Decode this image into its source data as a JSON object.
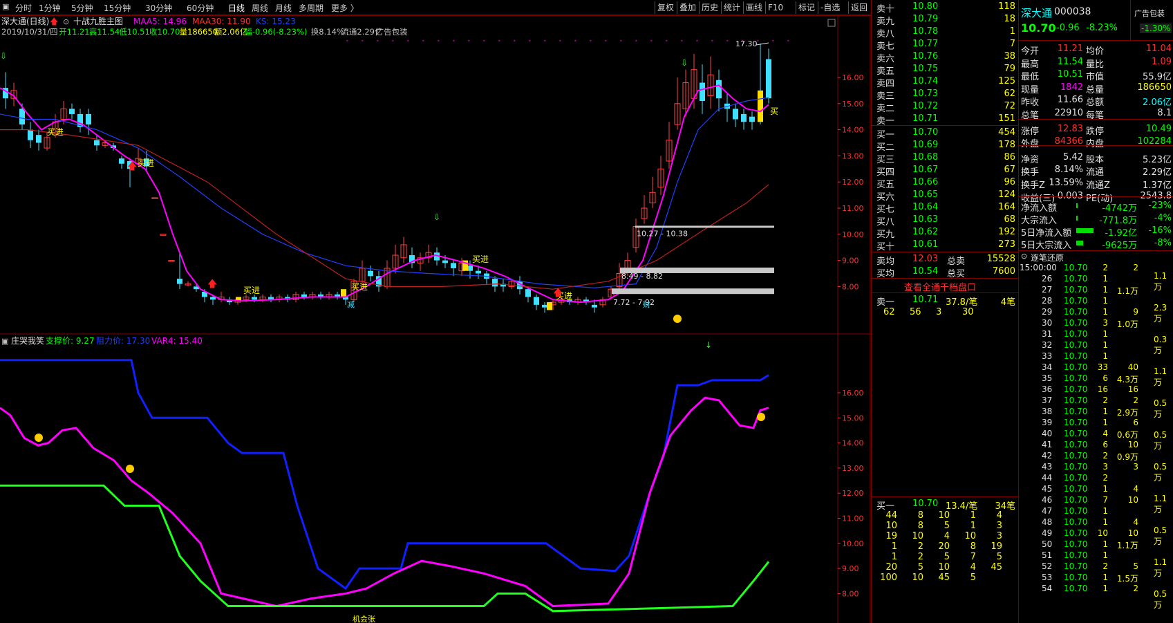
{
  "toolbar": {
    "periods": [
      "分时",
      "1分钟",
      "5分钟",
      "15分钟",
      "30分钟",
      "60分钟",
      "日线",
      "周线",
      "月线",
      "多周期",
      "更多 〉"
    ],
    "active": "日线",
    "right_buttons": [
      "复权",
      "叠加",
      "历史",
      "统计",
      "画线",
      "F10",
      "标记",
      "-自选",
      "返回"
    ]
  },
  "main_chart": {
    "title": "深大通(日线)",
    "indicator_name": "十战九胜主图",
    "ma_labels": [
      {
        "text": "MAA5: 14.96",
        "color": "#ff00ff"
      },
      {
        "text": "MAA30: 11.90",
        "color": "#ff3030"
      },
      {
        "text": "KS: 15.23",
        "color": "#2040ff"
      }
    ],
    "info_line": [
      {
        "t": "2019/10/31/四",
        "c": "#c0c0c0"
      },
      {
        "t": "开11.21",
        "c": "#00ff00"
      },
      {
        "t": "高11.54",
        "c": "#00ff00"
      },
      {
        "t": "低10.51",
        "c": "#00ff00"
      },
      {
        "t": "收10.70",
        "c": "#00ff00"
      },
      {
        "t": "量186650",
        "c": "#ffff00"
      },
      {
        "t": "额2.06亿",
        "c": "#ffff00"
      },
      {
        "t": "幅-0.96(-8.23%)",
        "c": "#00ff00"
      },
      {
        "t": "换8.14%",
        "c": "#c0c0c0"
      },
      {
        "t": "流通2.29亿",
        "c": "#c0c0c0"
      },
      {
        "t": "广告包装",
        "c": "#c0c0c0"
      }
    ],
    "y_ticks": [
      "16.00",
      "15.00",
      "14.00",
      "13.00",
      "12.00",
      "11.00",
      "10.00",
      "9.00",
      "8.00"
    ],
    "high_label": "17.30",
    "zones": [
      "10.27 - 10.38",
      "8.49 - 8.82",
      "7.72 - 7.92"
    ],
    "buy_labels": [
      "买进",
      "买进",
      "买进",
      "买进",
      "买进",
      "买进",
      "买"
    ],
    "markers": [
      "减",
      "财"
    ]
  },
  "sub_chart": {
    "indicator_name": "庄哭我笑",
    "labels": [
      {
        "text": "支撑价: 9.27",
        "color": "#00ff00"
      },
      {
        "text": "阻力价: 17.30",
        "color": "#2040ff"
      },
      {
        "text": "VAR4: 15.40",
        "color": "#ff00ff"
      }
    ],
    "y_ticks": [
      "16.00",
      "15.00",
      "14.00",
      "13.00",
      "12.00",
      "11.00",
      "10.00",
      "9.00",
      "8.00"
    ],
    "bottom_label": "机会张"
  },
  "orderbook": {
    "asks": [
      {
        "l": "卖十",
        "p": "10.80",
        "v": "118"
      },
      {
        "l": "卖九",
        "p": "10.79",
        "v": "18"
      },
      {
        "l": "卖八",
        "p": "10.78",
        "v": "1"
      },
      {
        "l": "卖七",
        "p": "10.77",
        "v": "7"
      },
      {
        "l": "卖六",
        "p": "10.76",
        "v": "38"
      },
      {
        "l": "卖五",
        "p": "10.75",
        "v": "79"
      },
      {
        "l": "卖四",
        "p": "10.74",
        "v": "125"
      },
      {
        "l": "卖三",
        "p": "10.73",
        "v": "62"
      },
      {
        "l": "卖二",
        "p": "10.72",
        "v": "72"
      },
      {
        "l": "卖一",
        "p": "10.71",
        "v": "151"
      }
    ],
    "bids": [
      {
        "l": "买一",
        "p": "10.70",
        "v": "454"
      },
      {
        "l": "买二",
        "p": "10.69",
        "v": "178"
      },
      {
        "l": "买三",
        "p": "10.68",
        "v": "86"
      },
      {
        "l": "买四",
        "p": "10.67",
        "v": "67"
      },
      {
        "l": "买五",
        "p": "10.66",
        "v": "96"
      },
      {
        "l": "买六",
        "p": "10.65",
        "v": "124"
      },
      {
        "l": "买七",
        "p": "10.64",
        "v": "164"
      },
      {
        "l": "买八",
        "p": "10.63",
        "v": "68"
      },
      {
        "l": "买九",
        "p": "10.62",
        "v": "192"
      },
      {
        "l": "买十",
        "p": "10.61",
        "v": "273"
      }
    ],
    "avg_ask": {
      "l": "卖均",
      "p": "12.03",
      "l2": "总卖",
      "v": "15528"
    },
    "avg_bid": {
      "l": "买均",
      "p": "10.54",
      "l2": "总买",
      "v": "7600"
    },
    "view_all": "查看全通千档盘口",
    "ask1_queue": {
      "l": "卖一",
      "p": "10.71",
      "avg": "37.8/笔",
      "n": "4笔",
      "orders": [
        [
          "62",
          "56",
          "3",
          "30"
        ]
      ]
    },
    "bid1_queue": {
      "l": "买一",
      "p": "10.70",
      "avg": "13.4/笔",
      "n": "34笔",
      "orders": [
        [
          "44",
          "8",
          "10",
          "1",
          "4"
        ],
        [
          "10",
          "8",
          "5",
          "1",
          "3"
        ],
        [
          "19",
          "10",
          "4",
          "10",
          "3"
        ],
        [
          "1",
          "2",
          "20",
          "8",
          "19"
        ],
        [
          "1",
          "2",
          "5",
          "7",
          "5"
        ],
        [
          "20",
          "5",
          "10",
          "4",
          "45"
        ],
        [
          "100",
          "10",
          "45",
          "5",
          ""
        ]
      ]
    }
  },
  "stock": {
    "name": "深大通",
    "code": "000038",
    "ad": "广告包装",
    "price": "10.70",
    "change": "-0.96",
    "pct": "-8.23%",
    "ad_pct": "-1.30%"
  },
  "quote": [
    [
      {
        "t": "今开",
        "c": "wht"
      },
      {
        "t": "11.21",
        "c": "red"
      },
      {
        "t": "均价",
        "c": "wht"
      },
      {
        "t": "11.04",
        "c": "red"
      }
    ],
    [
      {
        "t": "最高",
        "c": "wht"
      },
      {
        "t": "11.54",
        "c": "grn"
      },
      {
        "t": "量比",
        "c": "wht"
      },
      {
        "t": "1.09",
        "c": "red"
      }
    ],
    [
      {
        "t": "最低",
        "c": "wht"
      },
      {
        "t": "10.51",
        "c": "grn"
      },
      {
        "t": "市值",
        "c": "wht"
      },
      {
        "t": "55.9亿",
        "c": "wht"
      }
    ],
    [
      {
        "t": "现量",
        "c": "wht"
      },
      {
        "t": "1842",
        "c": "mag"
      },
      {
        "t": "总量",
        "c": "wht"
      },
      {
        "t": "186650",
        "c": "yel"
      }
    ],
    [
      {
        "t": "昨收",
        "c": "wht"
      },
      {
        "t": "11.66",
        "c": "wht"
      },
      {
        "t": "总额",
        "c": "wht"
      },
      {
        "t": "2.06亿",
        "c": "cy"
      }
    ],
    [
      {
        "t": "总笔",
        "c": "wht"
      },
      {
        "t": "22910",
        "c": "wht"
      },
      {
        "t": "每笔",
        "c": "wht"
      },
      {
        "t": "8.1",
        "c": "wht"
      }
    ],
    [
      {
        "t": "涨停",
        "c": "wht"
      },
      {
        "t": "12.83",
        "c": "red"
      },
      {
        "t": "跌停",
        "c": "wht"
      },
      {
        "t": "10.49",
        "c": "grn"
      }
    ],
    [
      {
        "t": "外盘",
        "c": "wht"
      },
      {
        "t": "84366",
        "c": "red"
      },
      {
        "t": "内盘",
        "c": "wht"
      },
      {
        "t": "102284",
        "c": "grn"
      }
    ],
    [
      {
        "t": "净资",
        "c": "wht"
      },
      {
        "t": "5.42",
        "c": "wht"
      },
      {
        "t": "股本",
        "c": "wht"
      },
      {
        "t": "5.23亿",
        "c": "wht"
      }
    ],
    [
      {
        "t": "换手",
        "c": "wht"
      },
      {
        "t": "8.14%",
        "c": "wht"
      },
      {
        "t": "流通",
        "c": "wht"
      },
      {
        "t": "2.29亿",
        "c": "wht"
      }
    ],
    [
      {
        "t": "换手Z",
        "c": "wht"
      },
      {
        "t": "13.59%",
        "c": "wht"
      },
      {
        "t": "流通Z",
        "c": "wht"
      },
      {
        "t": "1.37亿",
        "c": "wht"
      }
    ],
    [
      {
        "t": "收益(三)",
        "c": "wht"
      },
      {
        "t": "0.003",
        "c": "wht"
      },
      {
        "t": "PE(动)",
        "c": "wht"
      },
      {
        "t": "2543.8",
        "c": "wht"
      }
    ]
  ],
  "flows": [
    {
      "l": "净流入额",
      "v": "-4742万",
      "p": "-23%",
      "bar": 0.05
    },
    {
      "l": "大宗流入",
      "v": "-771.8万",
      "p": "-4%",
      "bar": 0.02
    },
    {
      "l": "5日净流入额",
      "v": "-1.92亿",
      "p": "-16%",
      "bar": 0.9
    },
    {
      "l": "5日大宗流入",
      "v": "-9625万",
      "p": "-8%",
      "bar": 0.35
    }
  ],
  "ticks_title": "逐笔还原",
  "ticks": [
    [
      "15:00:00",
      "10.70",
      "2",
      "2",
      ""
    ],
    [
      "26",
      "10.70",
      "1",
      "",
      ""
    ],
    [
      "27",
      "10.70",
      "1",
      "1.1万",
      ""
    ],
    [
      "28",
      "10.70",
      "1",
      "",
      ""
    ],
    [
      "29",
      "10.70",
      "1",
      "9",
      ""
    ],
    [
      "30",
      "10.70",
      "3",
      "1.0万",
      ""
    ],
    [
      "31",
      "10.70",
      "1",
      "",
      ""
    ],
    [
      "32",
      "10.70",
      "1",
      "",
      ""
    ],
    [
      "33",
      "10.70",
      "1",
      "",
      ""
    ],
    [
      "34",
      "10.70",
      "33",
      "40",
      ""
    ],
    [
      "35",
      "10.70",
      "6",
      "4.3万",
      ""
    ],
    [
      "36",
      "10.70",
      "16",
      "16",
      ""
    ],
    [
      "37",
      "10.70",
      "2",
      "2",
      ""
    ],
    [
      "38",
      "10.70",
      "1",
      "2.9万",
      ""
    ],
    [
      "39",
      "10.70",
      "1",
      "6",
      ""
    ],
    [
      "40",
      "10.70",
      "4",
      "0.6万",
      ""
    ],
    [
      "41",
      "10.70",
      "6",
      "10",
      ""
    ],
    [
      "42",
      "10.70",
      "2",
      "0.9万",
      ""
    ],
    [
      "43",
      "10.70",
      "3",
      "3",
      ""
    ],
    [
      "44",
      "10.70",
      "2",
      "",
      ""
    ],
    [
      "45",
      "10.70",
      "1",
      "4",
      ""
    ],
    [
      "46",
      "10.70",
      "7",
      "10",
      ""
    ],
    [
      "47",
      "10.70",
      "1",
      "",
      ""
    ],
    [
      "48",
      "10.70",
      "1",
      "4",
      ""
    ],
    [
      "49",
      "10.70",
      "10",
      "10",
      ""
    ],
    [
      "50",
      "10.70",
      "1",
      "1.1万",
      ""
    ],
    [
      "51",
      "10.70",
      "1",
      "",
      ""
    ],
    [
      "52",
      "10.70",
      "2",
      "5",
      ""
    ],
    [
      "53",
      "10.70",
      "1",
      "1.5万",
      ""
    ],
    [
      "54",
      "10.70",
      "1",
      "2",
      ""
    ]
  ],
  "ticks_extra": [
    "1.1万",
    "2.3万",
    "0.3万",
    "1.1万",
    "0.5万",
    "0.5万",
    "0.5万",
    "1.1万",
    "0.5万",
    "1.1万",
    "0.5万"
  ]
}
